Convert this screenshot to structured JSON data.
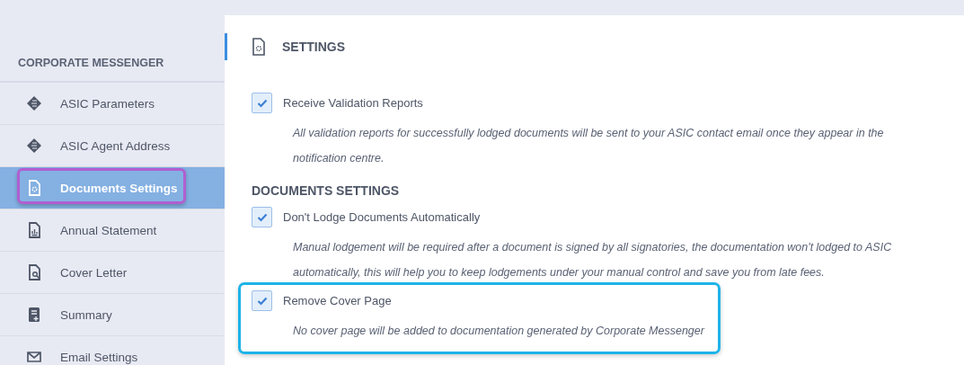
{
  "sidebar": {
    "heading": "CORPORATE MESSENGER",
    "items": [
      {
        "label": "ASIC Parameters",
        "selected": false,
        "highlighted": false
      },
      {
        "label": "ASIC Agent Address",
        "selected": false,
        "highlighted": false
      },
      {
        "label": "Documents Settings",
        "selected": true,
        "highlighted": true
      },
      {
        "label": "Annual Statement",
        "selected": false,
        "highlighted": false
      },
      {
        "label": "Cover Letter",
        "selected": false,
        "highlighted": false
      },
      {
        "label": "Summary",
        "selected": false,
        "highlighted": false
      },
      {
        "label": "Email Settings",
        "selected": false,
        "highlighted": false
      }
    ]
  },
  "main": {
    "title": "SETTINGS",
    "sections": [
      {
        "options": [
          {
            "label": "Receive Validation Reports",
            "checked": true,
            "highlighted": false,
            "description": "All validation reports for successfully lodged documents will be sent to your ASIC contact email once they appear in the notification centre."
          }
        ]
      },
      {
        "heading": "DOCUMENTS SETTINGS",
        "options": [
          {
            "label": "Don't Lodge Documents Automatically",
            "checked": true,
            "highlighted": false,
            "description": "Manual lodgement will be required after a document is signed by all signatories, the documentation won't lodged to ASIC automatically, this will help you to keep lodgements under your manual control and save you from late fees."
          },
          {
            "label": "Remove Cover Page",
            "checked": true,
            "highlighted": true,
            "description": "No cover page will be added to documentation generated by Corporate Messenger"
          }
        ]
      }
    ]
  }
}
